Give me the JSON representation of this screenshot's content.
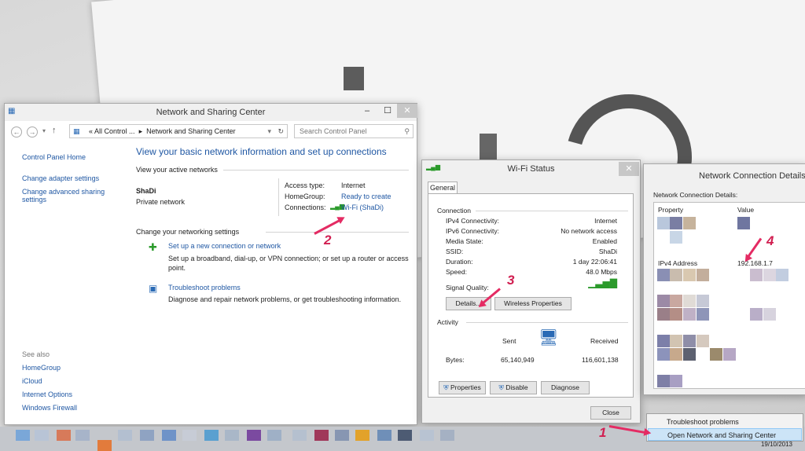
{
  "nsc": {
    "title": "Network and Sharing Center",
    "breadcrumb_root": "All Control ...",
    "breadcrumb_current": "Network and Sharing Center",
    "search_placeholder": "Search Control Panel",
    "left_top": [
      "Control Panel Home",
      "Change adapter settings",
      "Change advanced sharing settings"
    ],
    "see_also_label": "See also",
    "see_also": [
      "HomeGroup",
      "iCloud",
      "Internet Options",
      "Windows Firewall"
    ],
    "heading": "View your basic network information and set up connections",
    "active_networks": "View your active networks",
    "network_name": "ShaDi",
    "network_type": "Private network",
    "access_type_label": "Access type:",
    "access_type_value": "Internet",
    "homegroup_label": "HomeGroup:",
    "homegroup_value": "Ready to create",
    "connections_label": "Connections:",
    "connections_value": "Wi-Fi (ShaDi)",
    "change_settings": "Change your networking settings",
    "setup_link": "Set up a new connection or network",
    "setup_desc": "Set up a broadband, dial-up, or VPN connection; or set up a router or access point.",
    "trouble_link": "Troubleshoot problems",
    "trouble_desc": "Diagnose and repair network problems, or get troubleshooting information."
  },
  "wifi": {
    "title": "Wi-Fi Status",
    "tab": "General",
    "connection_label": "Connection",
    "rows": [
      {
        "label": "IPv4 Connectivity:",
        "value": "Internet"
      },
      {
        "label": "IPv6 Connectivity:",
        "value": "No network access"
      },
      {
        "label": "Media State:",
        "value": "Enabled"
      },
      {
        "label": "SSID:",
        "value": "ShaDi"
      },
      {
        "label": "Duration:",
        "value": "1 day 22:06:41"
      },
      {
        "label": "Speed:",
        "value": "48.0 Mbps"
      }
    ],
    "signal_label": "Signal Quality:",
    "details_btn": "Details...",
    "wireless_btn": "Wireless Properties",
    "activity_label": "Activity",
    "sent_label": "Sent",
    "received_label": "Received",
    "bytes_label": "Bytes:",
    "bytes_sent": "65,140,949",
    "bytes_received": "116,601,138",
    "properties_btn": "Properties",
    "disable_btn": "Disable",
    "diagnose_btn": "Diagnose",
    "close_btn": "Close"
  },
  "ncd": {
    "title": "Network Connection Details",
    "label": "Network Connection Details:",
    "col_property": "Property",
    "col_value": "Value",
    "ipv4_label": "IPv4 Address",
    "ipv4_value": "192.168.1.7"
  },
  "context_menu": {
    "items": [
      "Troubleshoot problems",
      "Open Network and Sharing Center"
    ]
  },
  "taskbar": {
    "date": "19/10/2013"
  },
  "annotations": [
    "1",
    "2",
    "3",
    "4"
  ],
  "colors": {
    "link": "#1f57a3",
    "annotation": "#e42b63",
    "highlight": "#cce4f7"
  }
}
